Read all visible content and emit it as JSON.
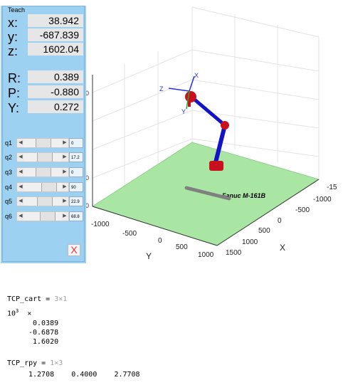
{
  "teach": {
    "title": "Teach",
    "position": [
      {
        "label": "x:",
        "value": "38.942"
      },
      {
        "label": "y:",
        "value": "-687.839"
      },
      {
        "label": "z:",
        "value": "1602.04"
      }
    ],
    "orientation": [
      {
        "label": "R:",
        "value": "0.389"
      },
      {
        "label": "P:",
        "value": "-0.880"
      },
      {
        "label": "Y:",
        "value": "0.272"
      }
    ],
    "joints": [
      {
        "label": "q1",
        "value": "0",
        "thumb": 0.5
      },
      {
        "label": "q2",
        "value": "17.2",
        "thumb": 0.55
      },
      {
        "label": "q3",
        "value": "0",
        "thumb": 0.5
      },
      {
        "label": "q4",
        "value": "90",
        "thumb": 0.75
      },
      {
        "label": "q5",
        "value": "22.9",
        "thumb": 0.57
      },
      {
        "label": "q6",
        "value": "68.8",
        "thumb": 0.68
      }
    ],
    "close_label": "X"
  },
  "plot": {
    "robot_label": "Fanuc M-161B",
    "axis_x_label": "X",
    "axis_y_label": "Y",
    "y_ticks": [
      "-1000",
      "-500",
      "0",
      "500",
      "1000"
    ],
    "x_ticks": [
      "-15",
      "-1000",
      "-500",
      "0",
      "500",
      "1000",
      "1500"
    ],
    "tool_axes": {
      "x": "X",
      "y": "Y",
      "z": "Z"
    },
    "colors": {
      "floor": "#a9e6a4",
      "links": "#1212c8",
      "joints": "#c8101e"
    }
  },
  "console": {
    "cart_name": "TCP_cart = ",
    "cart_size": "3×1",
    "cart_scale_base": "10",
    "cart_scale_exp": "3",
    "cart_scale_mult": "×",
    "cart_values": [
      "0.0389",
      "-0.6878",
      "1.6020"
    ],
    "rpy_name": "TCP_rpy = ",
    "rpy_size": "1×3",
    "rpy_values": [
      "1.2708",
      "0.4000",
      "2.7708"
    ]
  }
}
